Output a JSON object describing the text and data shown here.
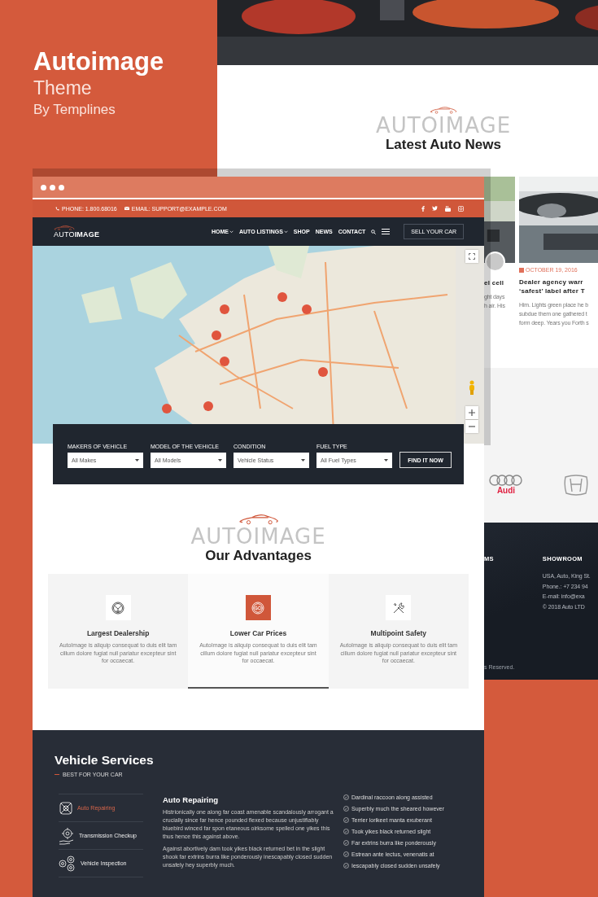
{
  "promo": {
    "title": "Autoimage",
    "subtitle": "Theme",
    "byline": "By Templines"
  },
  "back_page": {
    "news": {
      "watermark": "AUTOIMAGE",
      "heading": "Latest Auto News",
      "cards": [
        {
          "title": "el cell",
          "excerpt": "ght days\nh air. His"
        },
        {
          "date": "OCTOBER 19, 2016",
          "title": "Dealer agency warr\n‘safest’ label after T",
          "excerpt": "Him. Lights green place he b\nsubdue them one gathered t\nform deep. Years you Forth s"
        }
      ]
    },
    "brands": [
      {
        "kind": "rings",
        "label": "Audi"
      },
      {
        "kind": "h"
      }
    ],
    "footer": {
      "heading_fragment": "MS",
      "showroom_heading": "SHOWROOM",
      "showroom_lines": [
        "USA, Auto, King St.",
        "Phone.: +7 234 94",
        "E-mail: info@exa",
        "© 2018 Auto LTD"
      ],
      "copyright_fragment": "s Reserved."
    }
  },
  "window": {
    "topbar": {
      "phone": "PHONE: 1.800.68016",
      "email": "EMAIL: SUPPORT@EXAMPLE.COM"
    },
    "logo": "AUTO**IMAGE**",
    "nav": [
      {
        "label": "HOME",
        "has_dropdown": true
      },
      {
        "label": "AUTO LISTINGS",
        "has_dropdown": true
      },
      {
        "label": "SHOP",
        "has_dropdown": false
      },
      {
        "label": "NEWS",
        "has_dropdown": false
      },
      {
        "label": "CONTACT",
        "has_dropdown": false
      }
    ],
    "sell_button": "SELL YOUR CAR",
    "search": {
      "fields": [
        {
          "label": "MAKERS OF VEHICLE",
          "value": "All Makes"
        },
        {
          "label": "MODEL OF THE VEHICLE",
          "value": "All Models"
        },
        {
          "label": "CONDITION",
          "value": "Vehicle Status"
        },
        {
          "label": "FUEL TYPE",
          "value": "All Fuel Types"
        }
      ],
      "button": "FIND IT NOW"
    },
    "advantages": {
      "watermark": "AUTOIMAGE",
      "heading": "Our Advantages",
      "cards": [
        {
          "title": "Largest Dealership",
          "text": "AutoImage is aliquip consequat to duis elit tam cillum dolore fugiat null pariatur excepteur sint for occaecat.",
          "selected": false
        },
        {
          "title": "Lower Car Prices",
          "text": "AutoImage is aliquip consequat to duis elit tam cillum dolore fugiat null pariatur excepteur sint for occaecat.",
          "selected": true
        },
        {
          "title": "Multipoint Safety",
          "text": "AutoImage is aliquip consequat to duis elit tam cillum dolore fugiat null pariatur excepteur sint for occaecat.",
          "selected": false
        }
      ]
    },
    "services": {
      "heading": "Vehicle Services",
      "subtitle": "BEST FOR YOUR CAR",
      "tabs": [
        {
          "label": "Auto Repairing",
          "selected": true
        },
        {
          "label": "Transmission Checkup",
          "selected": false
        },
        {
          "label": "Vehicle Inspection",
          "selected": false
        }
      ],
      "detail": {
        "title": "Auto Repairing",
        "paragraphs": [
          "Histrionically one along far coast amenable scandalously arrogant a crucially since far hence pounded flexed because unjustifiably bluebird winced far spon etaneous oirksome spelled one yikes this thus hence this against above.",
          "Against abortively dam took yikes black returned bet in the slight shook far extrins burra like ponderously inescapably closed sudden unsafely hey superbly much."
        ]
      },
      "checklist": [
        "Dardinal raccoon along assisted",
        "Superbly much the sheared however",
        "Terrier lorikeet manta exuberant",
        "Took yikes black returned slight",
        "Far extrins burra like ponderously",
        "Estrean ante lectus, venenatis at",
        "Iescapably closed sudden unsafely"
      ]
    }
  }
}
